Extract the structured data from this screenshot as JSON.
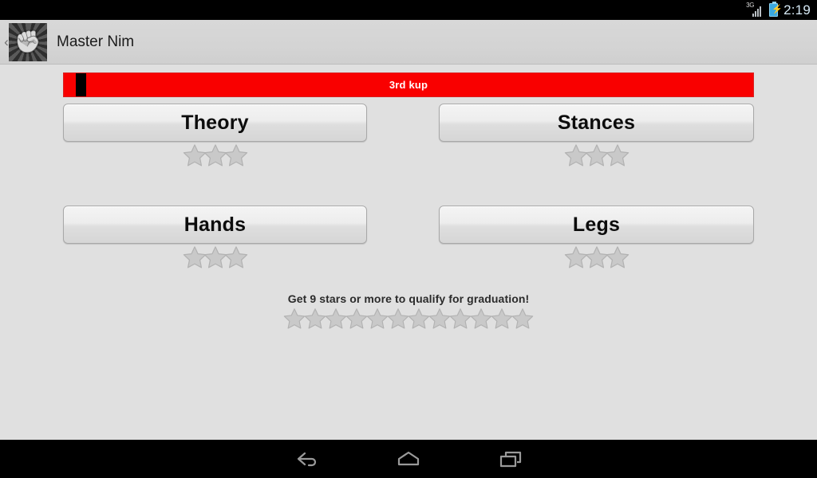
{
  "status_bar": {
    "network_label": "3G",
    "signal_icon": "signal-bars-icon",
    "battery_icon": "battery-charging-icon",
    "battery_bolt": "⚡",
    "time": "2:19"
  },
  "action_bar": {
    "back_chevron": "‹",
    "app_icon": "fist-app-icon",
    "app_icon_glyph": "✊",
    "title": "Master Nim"
  },
  "rank_bar": {
    "label": "3rd kup",
    "fill_color": "#f90000",
    "tick_color": "#000000",
    "text_color": "#ffffff"
  },
  "topics": [
    {
      "label": "Theory",
      "stars_total": 3,
      "stars_earned": 0
    },
    {
      "label": "Stances",
      "stars_total": 3,
      "stars_earned": 0
    },
    {
      "label": "Hands",
      "stars_total": 3,
      "stars_earned": 0
    },
    {
      "label": "Legs",
      "stars_total": 3,
      "stars_earned": 0
    }
  ],
  "graduation": {
    "text": "Get 9 stars or more to qualify for graduation!",
    "stars_total": 12,
    "stars_earned": 0
  },
  "star_colors": {
    "empty_fill": "#c9c9c9",
    "empty_stroke": "#b2b2b2"
  },
  "nav_bar": {
    "buttons": [
      {
        "name": "back-button",
        "icon": "back-arrow-icon"
      },
      {
        "name": "home-button",
        "icon": "home-icon"
      },
      {
        "name": "recents-button",
        "icon": "recents-icon"
      }
    ]
  }
}
